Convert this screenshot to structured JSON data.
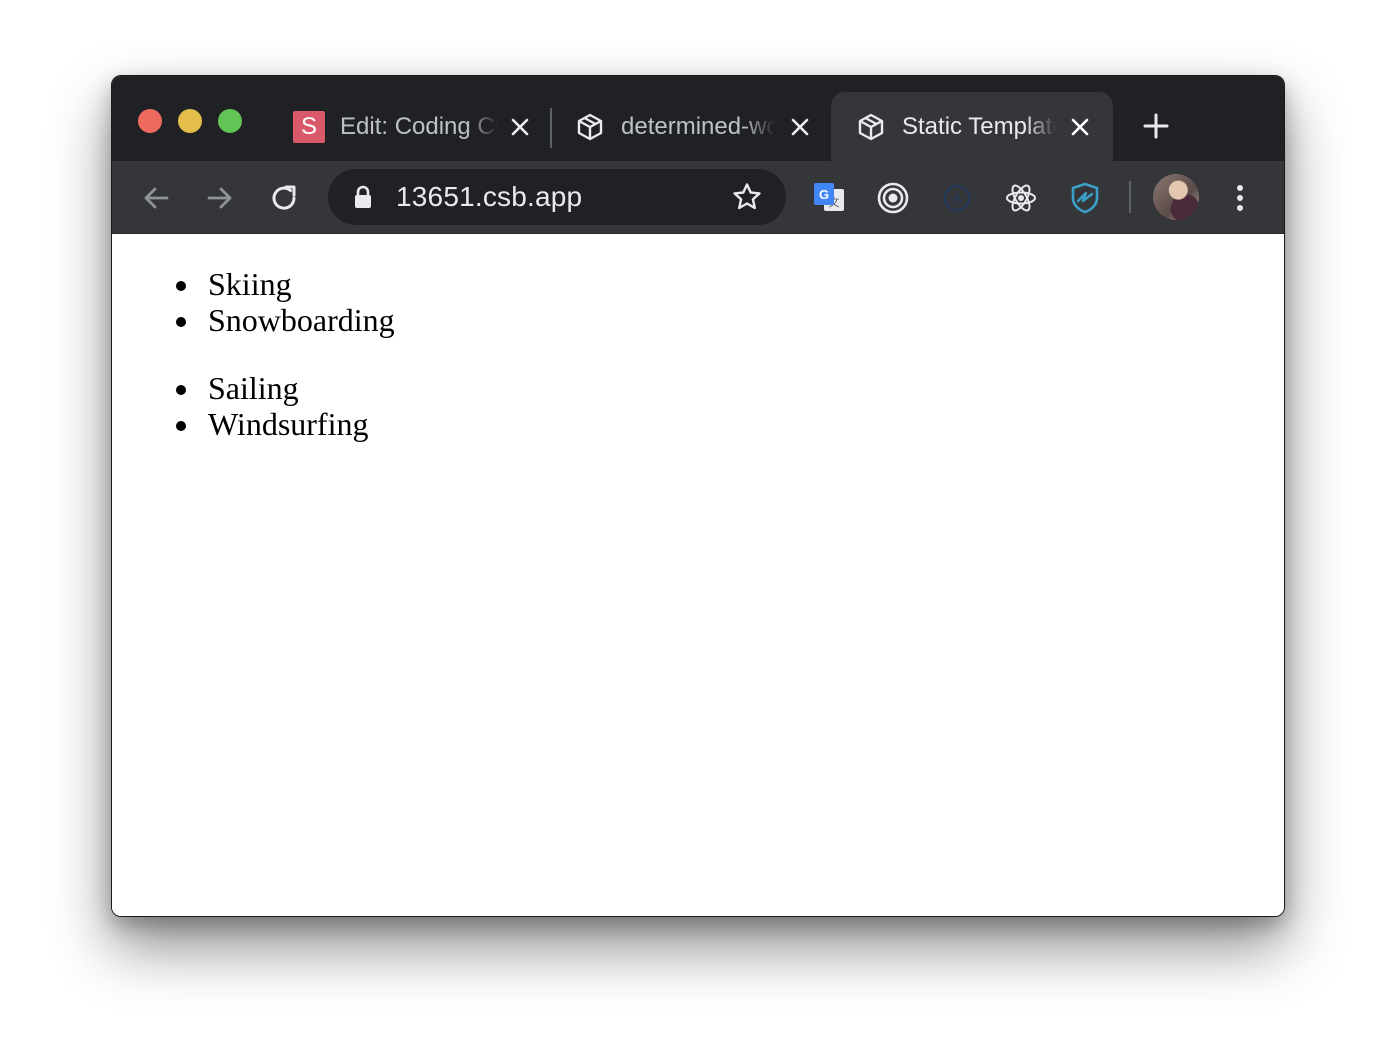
{
  "tabs": [
    {
      "title": "Edit: Coding Cheatsheet",
      "favicon": "s-icon",
      "favicon_letter": "S"
    },
    {
      "title": "determined-wood",
      "favicon": "codesandbox-icon"
    },
    {
      "title": "Static Template",
      "favicon": "codesandbox-icon",
      "active": true
    }
  ],
  "toolbar": {
    "url": "13651.csb.app"
  },
  "extensions": [
    "google-translate-icon",
    "target-icon",
    "a-circle-icon",
    "react-icon",
    "shield-icon"
  ],
  "page": {
    "list_1": [
      "Skiing",
      "Snowboarding"
    ],
    "list_2": [
      "Sailing",
      "Windsurfing"
    ]
  },
  "colors": {
    "tabstrip": "#202124",
    "toolbar": "#35363a",
    "omnibox": "#202124"
  }
}
